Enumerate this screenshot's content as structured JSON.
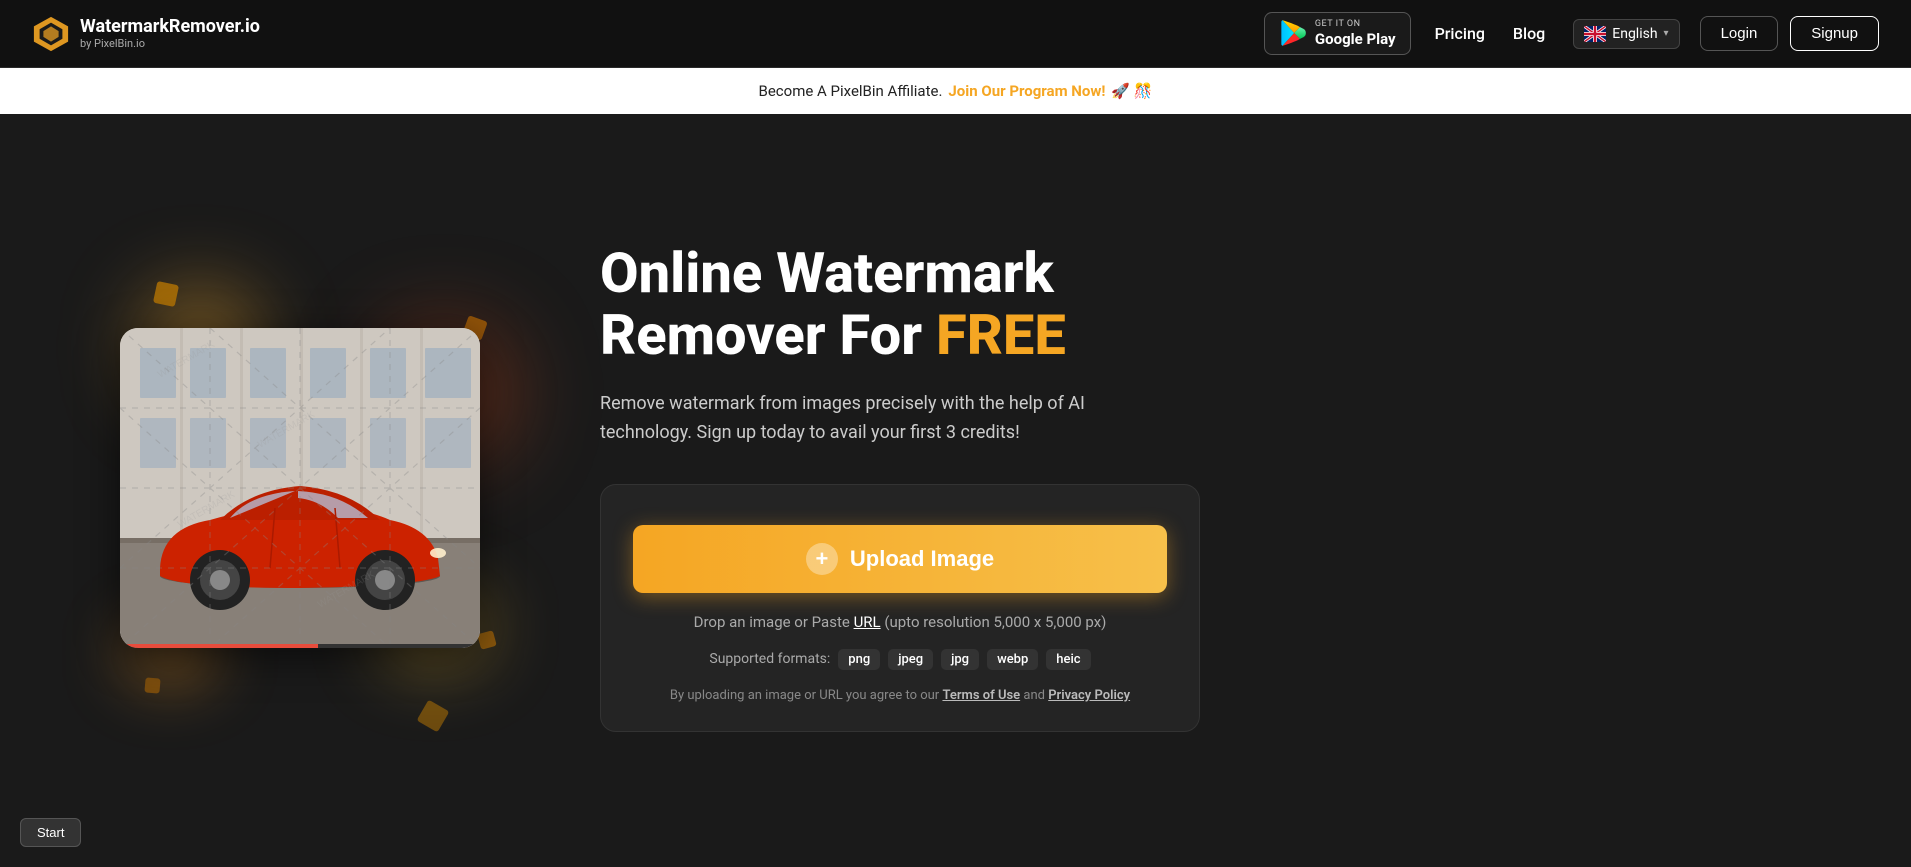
{
  "navbar": {
    "logo_title": "WatermarkRemover.io",
    "logo_sub": "by PixelBin.io",
    "google_play_get": "GET IT ON",
    "google_play_name": "Google Play",
    "pricing_label": "Pricing",
    "blog_label": "Blog",
    "lang_label": "English",
    "login_label": "Login",
    "signup_label": "Signup"
  },
  "affiliate_banner": {
    "text": "Become A PixelBin Affiliate.",
    "link_text": "Join Our Program Now!",
    "emojis": "🚀 🎊"
  },
  "hero": {
    "title_line1": "Online Watermark",
    "title_line2": "Remover For ",
    "title_free": "FREE",
    "subtitle": "Remove watermark from images precisely with the help of AI technology. Sign up today to avail your first 3 credits!",
    "upload_btn_label": "Upload Image",
    "drop_text": "Drop an image or Paste",
    "url_label": "URL",
    "resolution_text": "(upto resolution 5,000 x 5,000 px)",
    "formats_label": "Supported formats:",
    "formats": [
      "png",
      "jpeg",
      "jpg",
      "webp",
      "heic"
    ],
    "terms_text": "By uploading an image or URL you agree to our",
    "terms_link": "Terms of Use",
    "and_text": "and",
    "privacy_link": "Privacy Policy"
  },
  "start_button": {
    "label": "Start"
  }
}
